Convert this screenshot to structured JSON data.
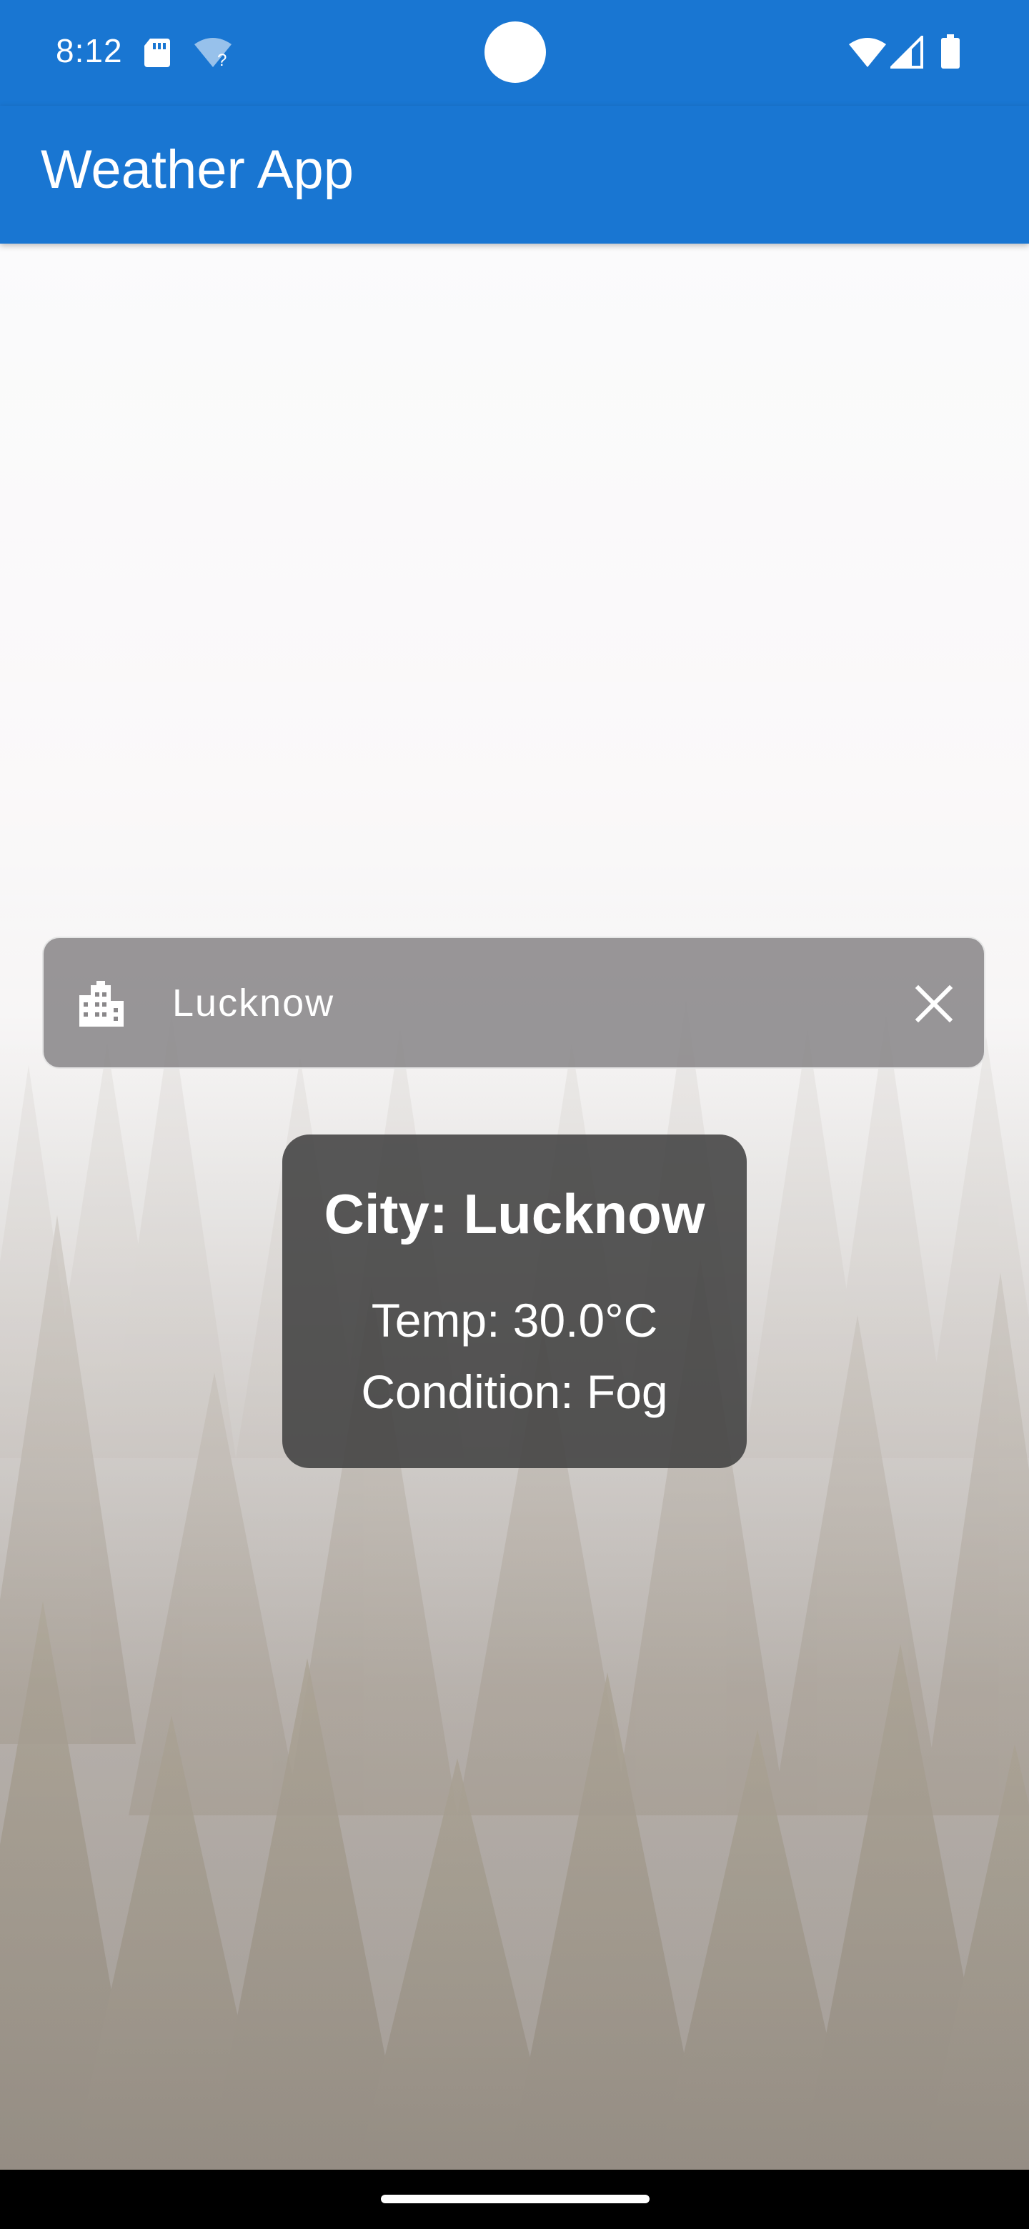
{
  "status_bar": {
    "time": "8:12",
    "icons": [
      "sd-card-icon",
      "wifi-question-icon",
      "wifi-icon",
      "signal-icon",
      "battery-icon"
    ],
    "color": "#1976D2"
  },
  "app_bar": {
    "title": "Weather App",
    "color": "#1976D2"
  },
  "search": {
    "icon": "city-icon",
    "value": "Lucknow",
    "clear_icon": "close-icon"
  },
  "weather": {
    "city_line": "City: Lucknow",
    "temp_line": "Temp: 30.0°C",
    "condition_line": "Condition: Fog"
  },
  "background": {
    "scene": "foggy-forest"
  }
}
